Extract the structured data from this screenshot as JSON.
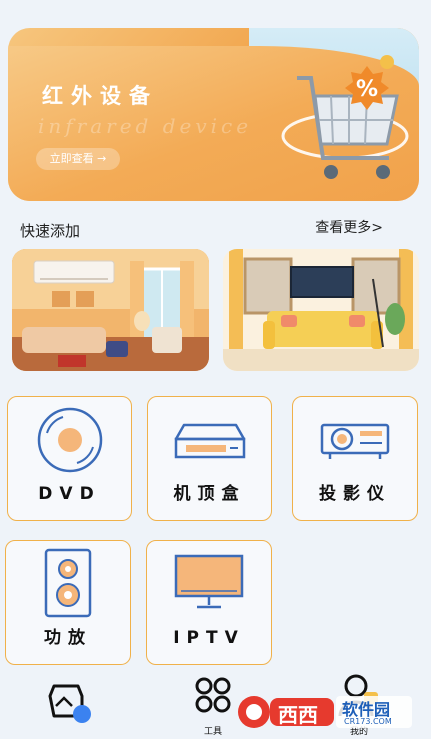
{
  "banner": {
    "title": "红外设备",
    "subtitle": "infrared device",
    "button_label": "立即查看 →"
  },
  "section": {
    "title": "快速添加",
    "more_label": "查看更多>"
  },
  "devices": [
    {
      "label": "DVD",
      "icon": "dvd-disc-icon"
    },
    {
      "label": "机顶盒",
      "icon": "set-top-box-icon"
    },
    {
      "label": "投影仪",
      "icon": "projector-icon"
    },
    {
      "label": "功放",
      "icon": "speaker-icon"
    },
    {
      "label": "IPTV",
      "icon": "tv-icon"
    }
  ],
  "tabs": [
    {
      "label": "",
      "icon": "home-icon"
    },
    {
      "label": "工具",
      "icon": "tools-icon"
    },
    {
      "label": "我的",
      "icon": "profile-icon"
    }
  ],
  "watermark": {
    "brand": "西西",
    "site": "CR173.COM",
    "tag": "软件园"
  },
  "colors": {
    "accent": "#f0b14a",
    "icon_stroke": "#3b6bb8",
    "icon_fill": "#f5b67a",
    "background": "#eef3f9"
  }
}
